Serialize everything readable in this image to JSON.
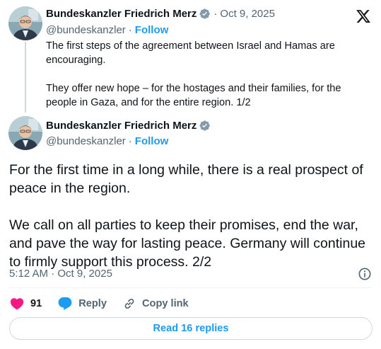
{
  "parent_tweet": {
    "author_name": "Bundeskanzler Friedrich Merz",
    "handle": "@bundeskanzler",
    "separator": "·",
    "follow_label": "Follow",
    "date": "Oct 9, 2025",
    "paragraphs": [
      "The first steps of the agreement between Israel and Hamas are encouraging.",
      "They offer new hope – for the hostages and their families, for the people in Gaza, and for the entire region. 1/2"
    ]
  },
  "main_tweet": {
    "author_name": "Bundeskanzler Friedrich Merz",
    "handle": "@bundeskanzler",
    "separator": "·",
    "follow_label": "Follow",
    "paragraphs": [
      "For the first time in a long while, there is a real prospect of peace in the region.",
      "We call on all parties to keep their promises, end the war, and pave the way for lasting peace. Germany will continue to firmly support this process. 2/2"
    ],
    "timestamp": "5:12 AM · Oct 9, 2025"
  },
  "actions": {
    "like_count": "91",
    "reply_label": "Reply",
    "copy_link_label": "Copy link"
  },
  "read_replies_label": "Read 16 replies",
  "icons": {
    "platform_logo": "x-logo-icon",
    "verified": "verified-badge-icon",
    "info": "info-icon",
    "like": "heart-icon",
    "reply": "speech-bubble-icon",
    "copy_link": "link-icon"
  },
  "colors": {
    "accent": "#1d9bf0",
    "like": "#f91880",
    "secondary_text": "#536471",
    "primary_text": "#0f1419",
    "verified_badge": "#829aab"
  }
}
